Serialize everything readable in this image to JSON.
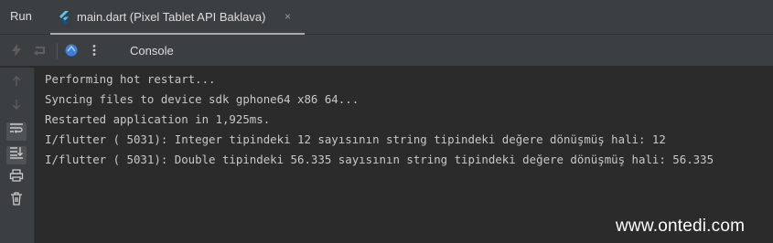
{
  "tabbar": {
    "run_label": "Run",
    "active_tab": {
      "title": "main.dart (Pixel Tablet API Baklava)",
      "close": "×"
    }
  },
  "toolbar": {
    "console_label": "Console",
    "icons": [
      "bolt-icon",
      "restart-icon",
      "flutter-devtools-icon",
      "more-vertical-icon"
    ]
  },
  "gutter": {
    "icons": [
      "arrow-up-icon",
      "arrow-down-icon",
      "soft-wrap-icon",
      "scroll-to-end-icon",
      "print-icon",
      "trash-icon"
    ]
  },
  "console": {
    "lines": [
      "Performing hot restart...",
      "Syncing files to device sdk gphone64 x86 64...",
      "Restarted application in 1,925ms.",
      "I/flutter ( 5031): Integer tipindeki 12 sayısının string tipindeki değere dönüşmüş hali: 12",
      "I/flutter ( 5031): Double tipindeki 56.335 sayısının string tipindeki değere dönüşmüş hali: 56.335"
    ]
  },
  "watermark": "www.ontedi.com"
}
